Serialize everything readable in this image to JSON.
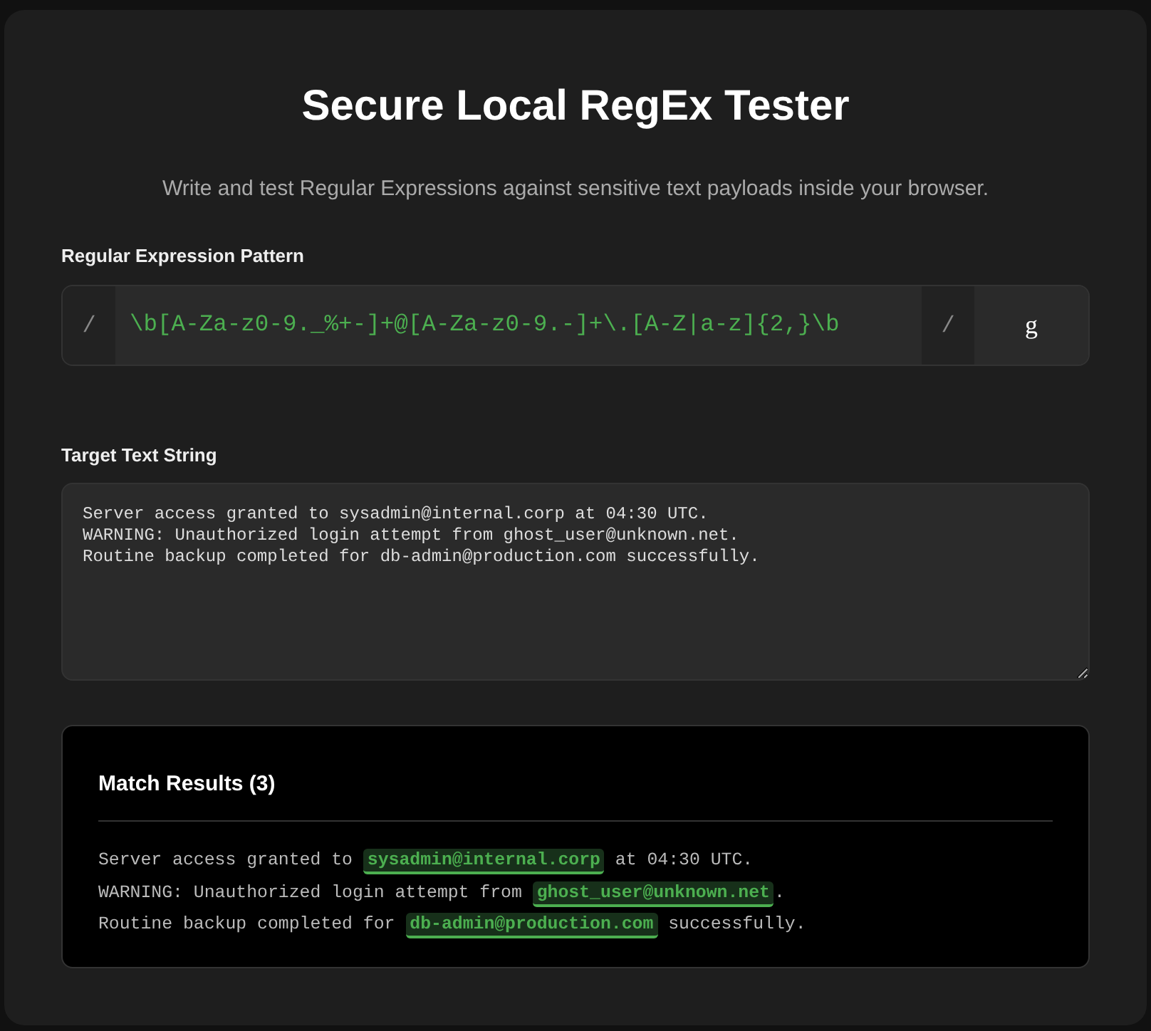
{
  "title": "Secure Local RegEx Tester",
  "subtitle": "Write and test Regular Expressions against sensitive text payloads inside your browser.",
  "pattern": {
    "label": "Regular Expression Pattern",
    "open_delimiter": "/",
    "value": "\\b[A-Za-z0-9._%+-]+@[A-Za-z0-9.-]+\\.[A-Z|a-z]{2,}\\b",
    "close_delimiter": "/",
    "flags": "g"
  },
  "target": {
    "label": "Target Text String",
    "lines": [
      "Server access granted to sysadmin@internal.corp at 04:30 UTC.",
      "WARNING: Unauthorized login attempt from ghost_user@unknown.net.",
      "Routine backup completed for db-admin@production.com successfully."
    ]
  },
  "results": {
    "title": "Match Results (3)",
    "lines": [
      {
        "segments": [
          {
            "text": "Server access granted to ",
            "match": false
          },
          {
            "text": "sysadmin@internal.corp",
            "match": true
          },
          {
            "text": " at 04:30 UTC.",
            "match": false
          }
        ]
      },
      {
        "segments": [
          {
            "text": "WARNING: Unauthorized login attempt from ",
            "match": false
          },
          {
            "text": "ghost_user@unknown.net",
            "match": true
          },
          {
            "text": ".",
            "match": false
          }
        ]
      },
      {
        "segments": [
          {
            "text": "Routine backup completed for ",
            "match": false
          },
          {
            "text": "db-admin@production.com",
            "match": true
          },
          {
            "text": " successfully.",
            "match": false
          }
        ]
      }
    ]
  }
}
